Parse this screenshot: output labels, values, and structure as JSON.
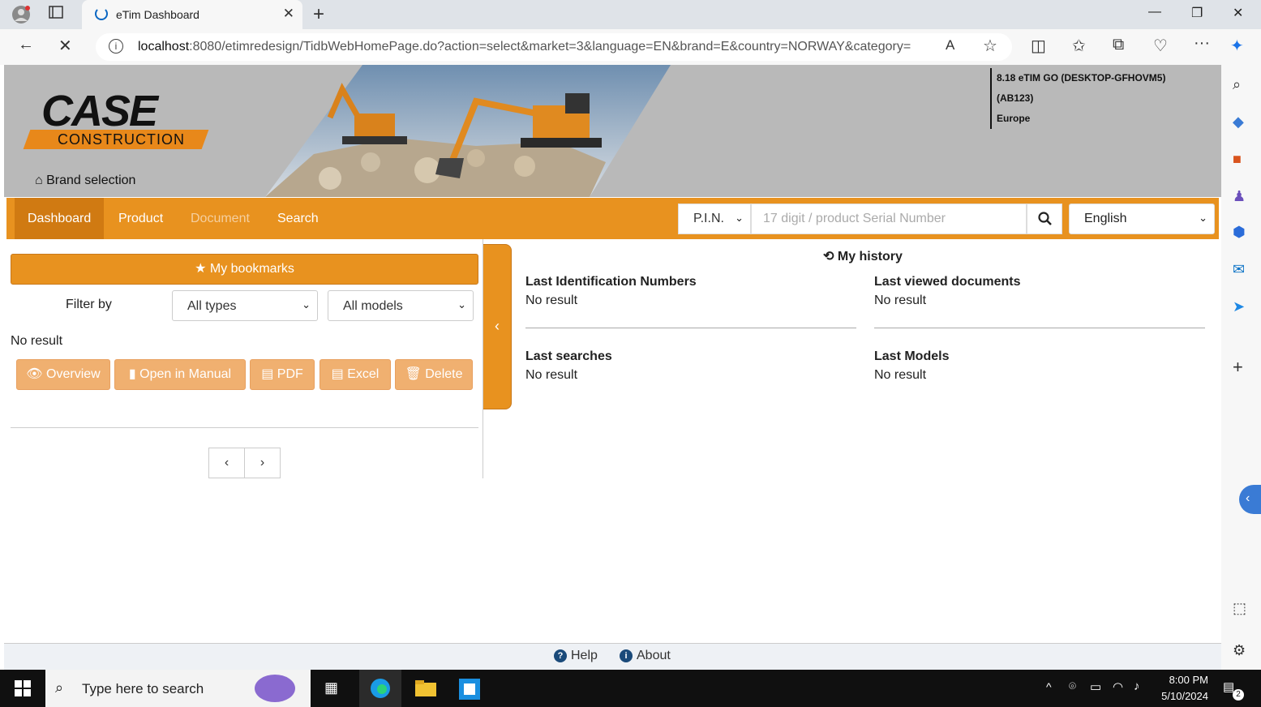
{
  "browser": {
    "tab_title": "eTim Dashboard",
    "url_host": "localhost",
    "url_rest": ":8080/etimredesign/TidbWebHomePage.do?action=select&market=3&language=EN&brand=E&country=NORWAY&category="
  },
  "header": {
    "logo_main": "CASE",
    "logo_sub": "CONSTRUCTION",
    "brand_selection": "Brand selection",
    "info_line1": "8.18 eTIM GO (DESKTOP-GFHOVM5)",
    "info_line2": "(AB123)",
    "info_line3": "Europe"
  },
  "nav": {
    "items": [
      "Dashboard",
      "Product",
      "Document",
      "Search"
    ],
    "pin_select": "P.I.N.",
    "serial_placeholder": "17 digit / product Serial Number",
    "language": "English"
  },
  "bookmarks": {
    "title": "My bookmarks",
    "filter_label": "Filter by",
    "type_filter": "All types",
    "model_filter": "All models",
    "no_result": "No result",
    "actions": [
      "Overview",
      "Open in Manual",
      "PDF",
      "Excel",
      "Delete"
    ]
  },
  "history": {
    "title": "My history",
    "sections": [
      {
        "heading": "Last Identification Numbers",
        "value": "No result"
      },
      {
        "heading": "Last viewed documents",
        "value": "No result"
      },
      {
        "heading": "Last searches",
        "value": "No result"
      },
      {
        "heading": "Last Models",
        "value": "No result"
      }
    ]
  },
  "footer": {
    "help": "Help",
    "about": "About"
  },
  "taskbar": {
    "search_placeholder": "Type here to search",
    "time": "8:00 PM",
    "date": "5/10/2024",
    "notifications": "2"
  },
  "colors": {
    "brand_orange": "#e8921f",
    "header_gray": "#b9b9b9"
  }
}
